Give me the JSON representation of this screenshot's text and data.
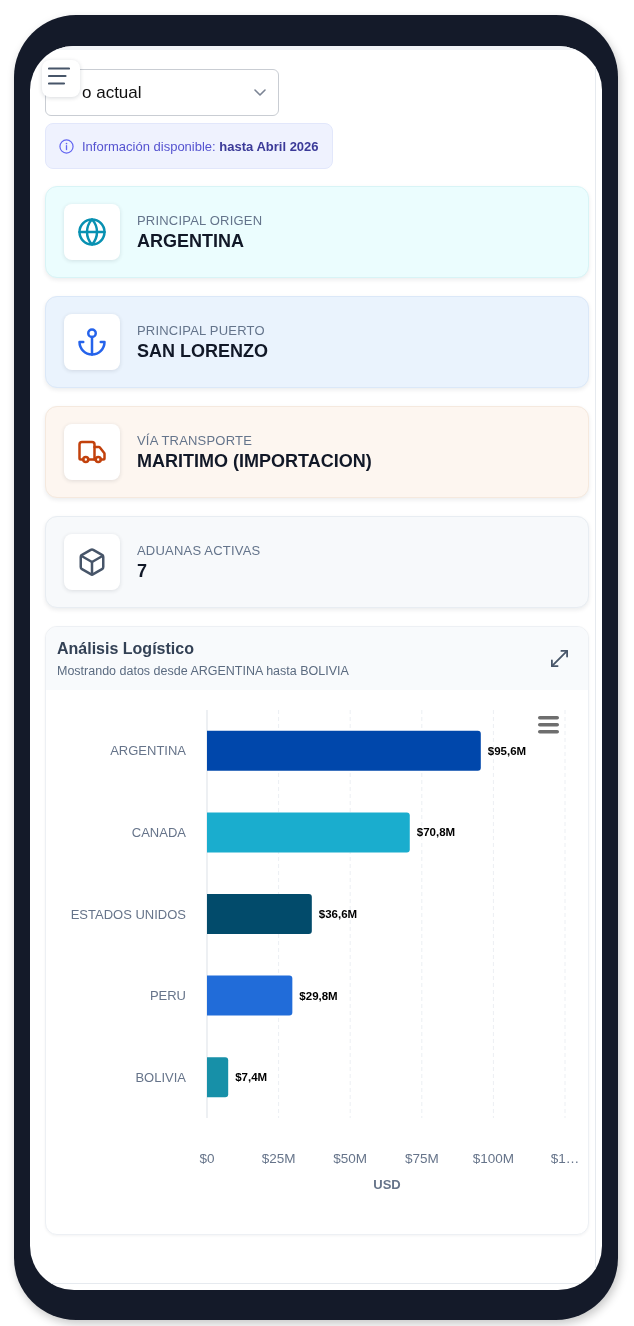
{
  "period_select": {
    "value": "o actual"
  },
  "info_banner": {
    "text": "Información disponible: **hasta Abril 2026**"
  },
  "kpi_cards": [
    {
      "kind": "origin",
      "label": "PRINCIPAL ORIGEN",
      "value": "ARGENTINA"
    },
    {
      "kind": "port",
      "label": "PRINCIPAL PUERTO",
      "value": "SAN LORENZO"
    },
    {
      "kind": "transport",
      "label": "VÍA TRANSPORTE",
      "value": "MARITIMO (IMPORTACION)"
    },
    {
      "kind": "customs",
      "label": "ADUANAS ACTIVAS",
      "value": "7"
    }
  ],
  "chart_panel": {
    "title": "Análisis Logístico",
    "subtitle": "Mostrando datos desde ARGENTINA hasta BOLIVIA",
    "chart_data": {
      "type": "bar",
      "orientation": "horizontal",
      "grid": true,
      "xlabel": "USD",
      "categories": [
        "ARGENTINA",
        "CANADA",
        "ESTADOS UNIDOS",
        "PERU",
        "BOLIVIA"
      ],
      "values": [
        95.6,
        70.8,
        36.6,
        29.8,
        7.4
      ],
      "colors": [
        "#0047ab",
        "#1aadce",
        "#024b6b",
        "#216cd9",
        "#1790a8"
      ],
      "value_labels": [
        "$95,6M",
        "$70,8M",
        "$36,6M",
        "$29,8M",
        "$7,4M"
      ],
      "xlim": [
        0,
        125
      ],
      "xticks": [
        {
          "value": 0,
          "label": "$0"
        },
        {
          "value": 25,
          "label": "$25M"
        },
        {
          "value": 50,
          "label": "$50M"
        },
        {
          "value": 75,
          "label": "$75M"
        },
        {
          "value": 100,
          "label": "$100M"
        },
        {
          "value": 125,
          "label": "$1…"
        }
      ]
    }
  }
}
